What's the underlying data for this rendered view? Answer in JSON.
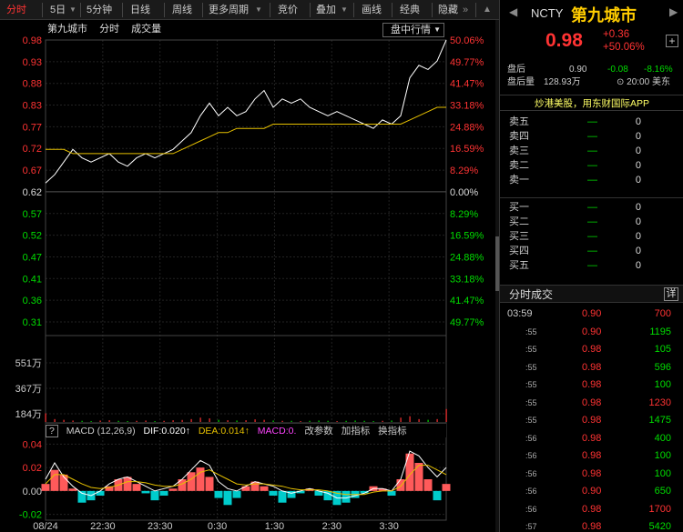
{
  "toolbar": {
    "items": [
      {
        "label": "分时",
        "active": true
      },
      {
        "label": "5日"
      },
      {
        "label": "5分钟"
      },
      {
        "label": "日线"
      },
      {
        "label": "周线"
      },
      {
        "label": "更多周期"
      },
      {
        "label": "竞价"
      },
      {
        "label": "叠加"
      },
      {
        "label": "画线"
      },
      {
        "label": "经典"
      },
      {
        "label": "隐藏"
      }
    ],
    "more_arrows": "»"
  },
  "chart": {
    "stock_name": "第九城市",
    "mode_label": "分时",
    "volume_label": "成交量",
    "pan_button": "盘中行情",
    "price_ticks": [
      "0.98",
      "0.93",
      "0.88",
      "0.83",
      "0.77",
      "0.72",
      "0.67",
      "0.62",
      "0.57",
      "0.52",
      "0.47",
      "0.41",
      "0.36",
      "0.31"
    ],
    "pct_ticks": [
      "50.06%",
      "49.77%",
      "41.47%",
      "33.18%",
      "24.88%",
      "16.59%",
      "8.29%",
      "0.00%",
      "8.29%",
      "16.59%",
      "24.88%",
      "33.18%",
      "41.47%",
      "49.77%"
    ],
    "volume_ticks": [
      "551万",
      "367万",
      "184万"
    ],
    "macd_ticks": [
      "0.04",
      "0.02",
      "0.00",
      "-0.02"
    ],
    "time_ticks": [
      "08/24",
      "22:30",
      "23:30",
      "0:30",
      "1:30",
      "2:30",
      "3:30"
    ],
    "colors": {
      "price_line": "#ffffff",
      "avg_line": "#e6c000",
      "up": "#ff3333",
      "down": "#00dd00",
      "macd_neg": "#00cccc"
    }
  },
  "chart_data": [
    {
      "type": "line",
      "title": "第九城市 分时",
      "ylim": [
        0.31,
        0.98
      ],
      "x_ticks": [
        "08/24",
        "22:30",
        "23:30",
        "0:30",
        "1:30",
        "2:30",
        "3:30"
      ],
      "series": [
        {
          "name": "price",
          "values": [
            0.64,
            0.66,
            0.69,
            0.72,
            0.7,
            0.69,
            0.7,
            0.71,
            0.69,
            0.68,
            0.7,
            0.71,
            0.7,
            0.71,
            0.72,
            0.74,
            0.76,
            0.8,
            0.83,
            0.8,
            0.82,
            0.8,
            0.81,
            0.84,
            0.86,
            0.82,
            0.84,
            0.83,
            0.84,
            0.82,
            0.81,
            0.8,
            0.81,
            0.8,
            0.79,
            0.78,
            0.77,
            0.79,
            0.78,
            0.8,
            0.89,
            0.92,
            0.91,
            0.93,
            0.98
          ]
        },
        {
          "name": "avg",
          "values": [
            0.72,
            0.72,
            0.72,
            0.71,
            0.71,
            0.71,
            0.71,
            0.71,
            0.71,
            0.71,
            0.71,
            0.71,
            0.71,
            0.71,
            0.71,
            0.72,
            0.73,
            0.74,
            0.75,
            0.76,
            0.76,
            0.77,
            0.77,
            0.77,
            0.77,
            0.78,
            0.78,
            0.78,
            0.78,
            0.78,
            0.78,
            0.78,
            0.78,
            0.78,
            0.78,
            0.78,
            0.78,
            0.78,
            0.78,
            0.78,
            0.79,
            0.8,
            0.81,
            0.82,
            0.82
          ]
        }
      ]
    },
    {
      "type": "bar",
      "title": "成交量",
      "ylim": [
        0,
        551
      ],
      "values": [
        60,
        20,
        15,
        10,
        8,
        6,
        10,
        12,
        8,
        6,
        8,
        10,
        6,
        8,
        12,
        14,
        20,
        30,
        25,
        15,
        12,
        10,
        12,
        18,
        15,
        10,
        8,
        8,
        6,
        8,
        10,
        8,
        6,
        8,
        10,
        8,
        6,
        8,
        10,
        30,
        40,
        20,
        15,
        20,
        90
      ]
    },
    {
      "type": "bar",
      "title": "MACD (12,26,9)",
      "ylim": [
        -0.025,
        0.045
      ],
      "series": [
        {
          "name": "MACD",
          "values": [
            0.006,
            0.018,
            0.014,
            0.002,
            -0.01,
            -0.008,
            -0.004,
            0.004,
            0.01,
            0.012,
            0.006,
            -0.002,
            -0.008,
            -0.004,
            0.002,
            0.01,
            0.016,
            0.02,
            0.012,
            -0.006,
            -0.012,
            -0.006,
            0.004,
            0.008,
            0.004,
            -0.004,
            -0.01,
            -0.006,
            -0.002,
            0.002,
            -0.004,
            -0.008,
            -0.012,
            -0.01,
            -0.006,
            -0.002,
            0.004,
            0.002,
            -0.004,
            0.01,
            0.032,
            0.024,
            0.01,
            -0.008,
            0.006
          ]
        },
        {
          "name": "DIF",
          "values": [
            0.01,
            0.024,
            0.012,
            0.004,
            -0.002,
            -0.004,
            0.0,
            0.006,
            0.01,
            0.012,
            0.008,
            0.004,
            0.0,
            0.002,
            0.004,
            0.01,
            0.018,
            0.026,
            0.022,
            0.008,
            0.002,
            0.0,
            0.004,
            0.008,
            0.006,
            0.004,
            0.0,
            -0.002,
            0.0,
            0.002,
            0.0,
            -0.002,
            -0.006,
            -0.006,
            -0.004,
            -0.002,
            0.002,
            0.002,
            0.0,
            0.01,
            0.034,
            0.03,
            0.02,
            0.012,
            0.02
          ]
        },
        {
          "name": "DEA",
          "values": [
            0.006,
            0.014,
            0.014,
            0.01,
            0.006,
            0.003,
            0.002,
            0.003,
            0.005,
            0.008,
            0.008,
            0.007,
            0.005,
            0.004,
            0.004,
            0.006,
            0.01,
            0.016,
            0.018,
            0.014,
            0.01,
            0.006,
            0.005,
            0.006,
            0.006,
            0.005,
            0.004,
            0.002,
            0.001,
            0.001,
            0.001,
            0.0,
            -0.002,
            -0.003,
            -0.003,
            -0.003,
            -0.001,
            0.0,
            0.0,
            0.004,
            0.014,
            0.022,
            0.022,
            0.018,
            0.014
          ]
        }
      ]
    }
  ],
  "macd_bar": {
    "help": "?",
    "name": "MACD (12,26,9)",
    "dif": "DIF:0.020↑",
    "dea": "DEA:0.014↑",
    "macd": "MACD:0.",
    "btn_params": "改参数",
    "btn_add": "加指标",
    "btn_switch": "换指标"
  },
  "quote": {
    "left_arrow": "◀",
    "right_arrow": "▶",
    "symbol": "NCTY",
    "name": "第九城市",
    "price": "0.98",
    "change": "+0.36",
    "change_pct": "+50.06%",
    "plus": "+",
    "after_hours": {
      "label": "盘后",
      "price": "0.90",
      "change": "-0.08",
      "change_pct": "-8.16%",
      "vol_label": "盘后量",
      "vol": "128.93万",
      "time": "⊙ 20:00 美东"
    },
    "promo": "炒港美股，用东财国际APP",
    "asks": [
      {
        "label": "卖五",
        "price": "—",
        "qty": "0"
      },
      {
        "label": "卖四",
        "price": "—",
        "qty": "0"
      },
      {
        "label": "卖三",
        "price": "—",
        "qty": "0"
      },
      {
        "label": "卖二",
        "price": "—",
        "qty": "0"
      },
      {
        "label": "卖一",
        "price": "—",
        "qty": "0"
      }
    ],
    "bids": [
      {
        "label": "买一",
        "price": "—",
        "qty": "0"
      },
      {
        "label": "买二",
        "price": "—",
        "qty": "0"
      },
      {
        "label": "买三",
        "price": "—",
        "qty": "0"
      },
      {
        "label": "买四",
        "price": "—",
        "qty": "0"
      },
      {
        "label": "买五",
        "price": "—",
        "qty": "0"
      }
    ],
    "ticks_title": "分时成交",
    "ticks_detail": "详",
    "ticks": [
      {
        "time": "03:59",
        "price": "0.90",
        "vol": "700",
        "dir": "red"
      },
      {
        "time": ":55",
        "price": "0.90",
        "vol": "1195",
        "dir": "green"
      },
      {
        "time": ":55",
        "price": "0.98",
        "vol": "105",
        "dir": "green"
      },
      {
        "time": ":55",
        "price": "0.98",
        "vol": "596",
        "dir": "green"
      },
      {
        "time": ":55",
        "price": "0.98",
        "vol": "100",
        "dir": "green"
      },
      {
        "time": ":55",
        "price": "0.98",
        "vol": "1230",
        "dir": "red"
      },
      {
        "time": ":55",
        "price": "0.98",
        "vol": "1475",
        "dir": "green"
      },
      {
        "time": ":56",
        "price": "0.98",
        "vol": "400",
        "dir": "green"
      },
      {
        "time": ":56",
        "price": "0.98",
        "vol": "100",
        "dir": "green"
      },
      {
        "time": ":56",
        "price": "0.98",
        "vol": "100",
        "dir": "green"
      },
      {
        "time": ":56",
        "price": "0.90",
        "vol": "650",
        "dir": "green"
      },
      {
        "time": ":56",
        "price": "0.98",
        "vol": "1700",
        "dir": "red"
      },
      {
        "time": ":57",
        "price": "0.98",
        "vol": "5420",
        "dir": "green"
      }
    ]
  }
}
